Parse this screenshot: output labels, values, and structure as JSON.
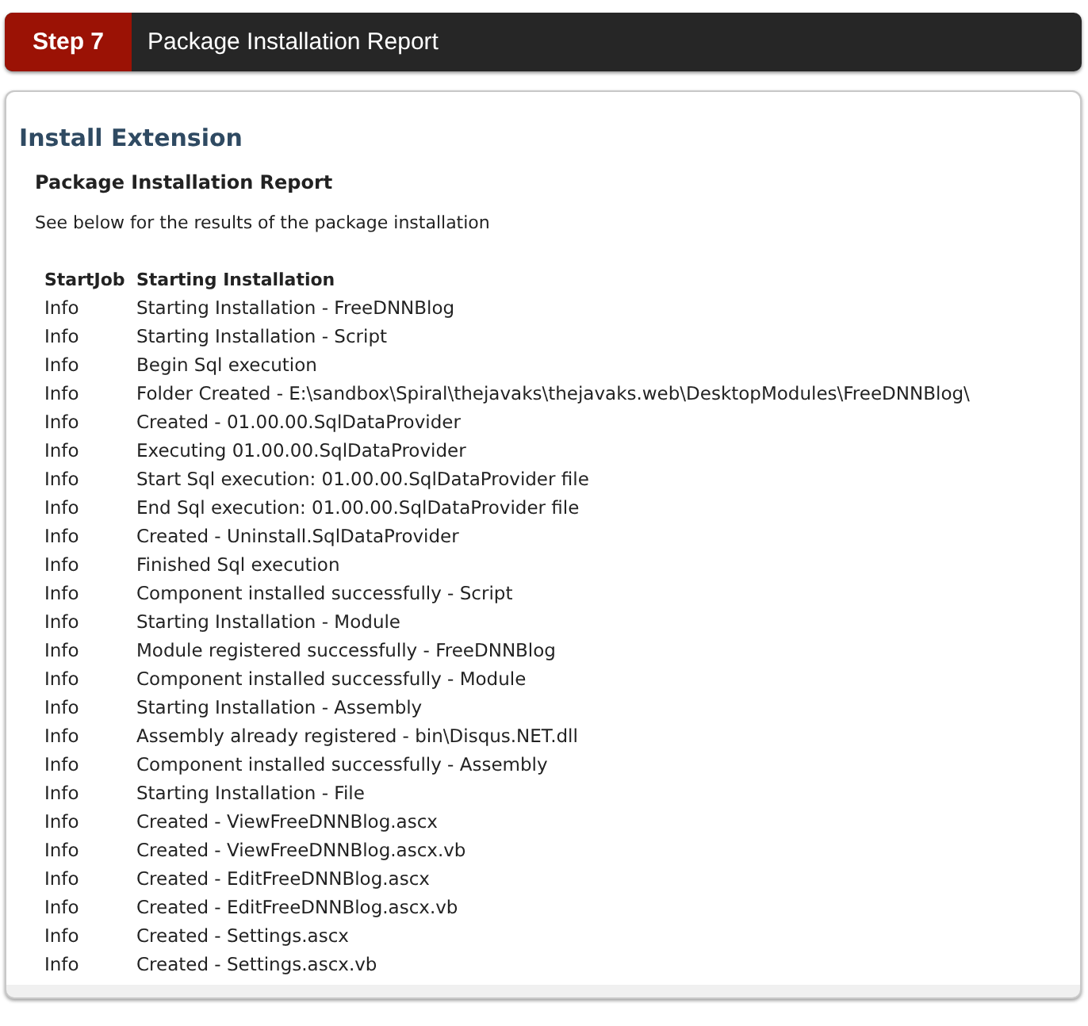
{
  "step": {
    "label": "Step 7",
    "title": "Package Installation Report"
  },
  "panel": {
    "title": "Install Extension",
    "heading": "Package Installation Report",
    "intro": "See below for the results of the package installation"
  },
  "log": {
    "columns": [
      "StartJob",
      "Starting Installation"
    ],
    "rows": [
      [
        "Info",
        "Starting Installation - FreeDNNBlog"
      ],
      [
        "Info",
        "Starting Installation - Script"
      ],
      [
        "Info",
        "Begin Sql execution"
      ],
      [
        "Info",
        "Folder Created - E:\\sandbox\\Spiral\\thejavaks\\thejavaks.web\\DesktopModules\\FreeDNNBlog\\"
      ],
      [
        "Info",
        "Created - 01.00.00.SqlDataProvider"
      ],
      [
        "Info",
        "Executing 01.00.00.SqlDataProvider"
      ],
      [
        "Info",
        "Start Sql execution: 01.00.00.SqlDataProvider file"
      ],
      [
        "Info",
        "End Sql execution: 01.00.00.SqlDataProvider file"
      ],
      [
        "Info",
        "Created - Uninstall.SqlDataProvider"
      ],
      [
        "Info",
        "Finished Sql execution"
      ],
      [
        "Info",
        "Component installed successfully - Script"
      ],
      [
        "Info",
        "Starting Installation - Module"
      ],
      [
        "Info",
        "Module registered successfully - FreeDNNBlog"
      ],
      [
        "Info",
        "Component installed successfully - Module"
      ],
      [
        "Info",
        "Starting Installation - Assembly"
      ],
      [
        "Info",
        "Assembly already registered - bin\\Disqus.NET.dll"
      ],
      [
        "Info",
        "Component installed successfully - Assembly"
      ],
      [
        "Info",
        "Starting Installation - File"
      ],
      [
        "Info",
        "Created - ViewFreeDNNBlog.ascx"
      ],
      [
        "Info",
        "Created - ViewFreeDNNBlog.ascx.vb"
      ],
      [
        "Info",
        "Created - EditFreeDNNBlog.ascx"
      ],
      [
        "Info",
        "Created - EditFreeDNNBlog.ascx.vb"
      ],
      [
        "Info",
        "Created - Settings.ascx"
      ],
      [
        "Info",
        "Created - Settings.ascx.vb"
      ]
    ]
  }
}
